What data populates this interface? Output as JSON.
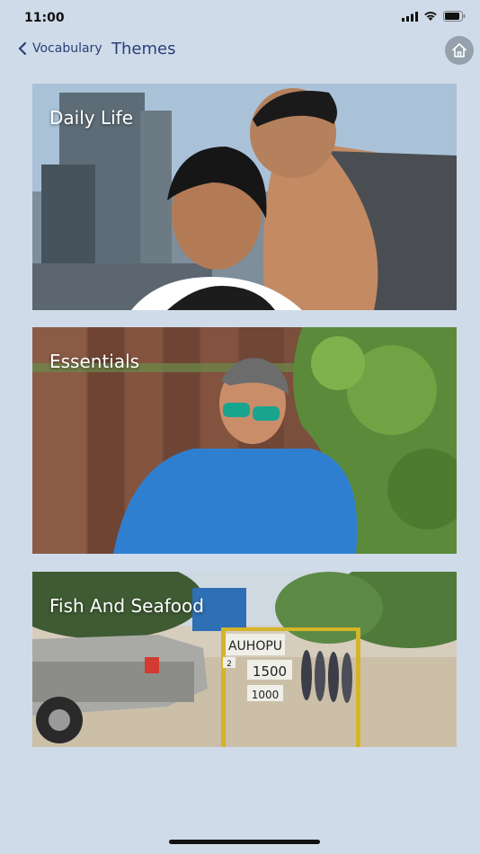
{
  "status": {
    "time": "11:00"
  },
  "nav": {
    "back_label": "Vocabulary",
    "title": "Themes",
    "home_icon": "home-icon"
  },
  "themes": [
    {
      "title": "Daily Life"
    },
    {
      "title": "Essentials"
    },
    {
      "title": "Fish And Seafood"
    }
  ],
  "signs": {
    "name": "AUHOPU",
    "price_main": "1500",
    "price_small": "1000",
    "number": "2"
  },
  "colors": {
    "background": "#cfdbe8",
    "accent": "#2a3f7a",
    "home_button": "#95a1ad"
  }
}
